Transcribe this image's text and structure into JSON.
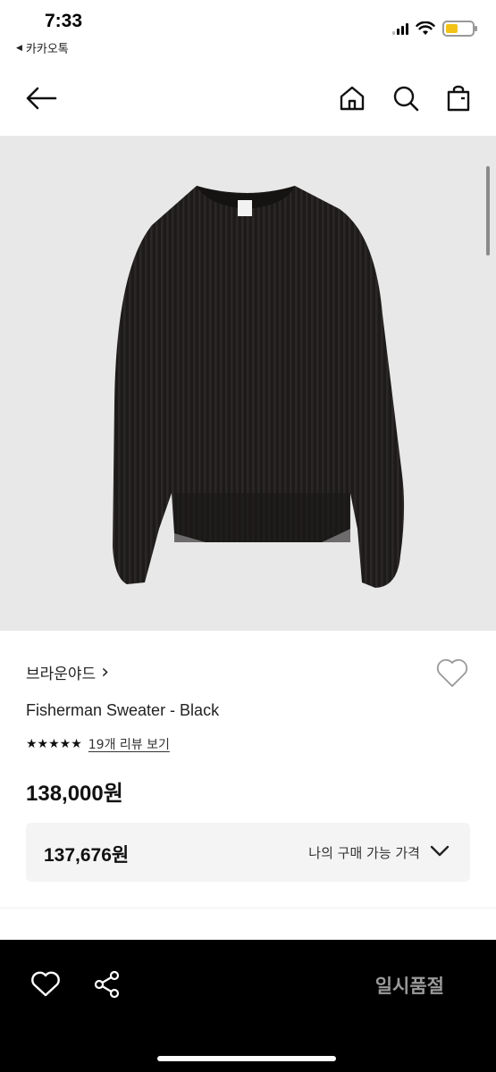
{
  "status_bar": {
    "time": "7:33",
    "back_app": "카카오톡"
  },
  "header": {
    "icons": [
      "back-arrow-icon",
      "home-icon",
      "search-icon",
      "bag-icon"
    ]
  },
  "product": {
    "brand": "브라운야드",
    "brand_chevron": "›",
    "name": "Fisherman Sweater - Black",
    "stars": "★★★★★",
    "rating": 5,
    "review_link": "19개 리뷰 보기",
    "price": "138,000원",
    "my_price": "137,676원",
    "my_price_label": "나의 구매 가능 가격",
    "image_icon": "sweater-image"
  },
  "bottom_bar": {
    "soldout_label": "일시품절",
    "icons": [
      "heart-icon",
      "share-icon"
    ]
  },
  "colors": {
    "battery": "#f2c316",
    "image_bg": "#e8e8e8",
    "bottom_bar": "#000000",
    "soldout_text": "#9a9a9a"
  }
}
